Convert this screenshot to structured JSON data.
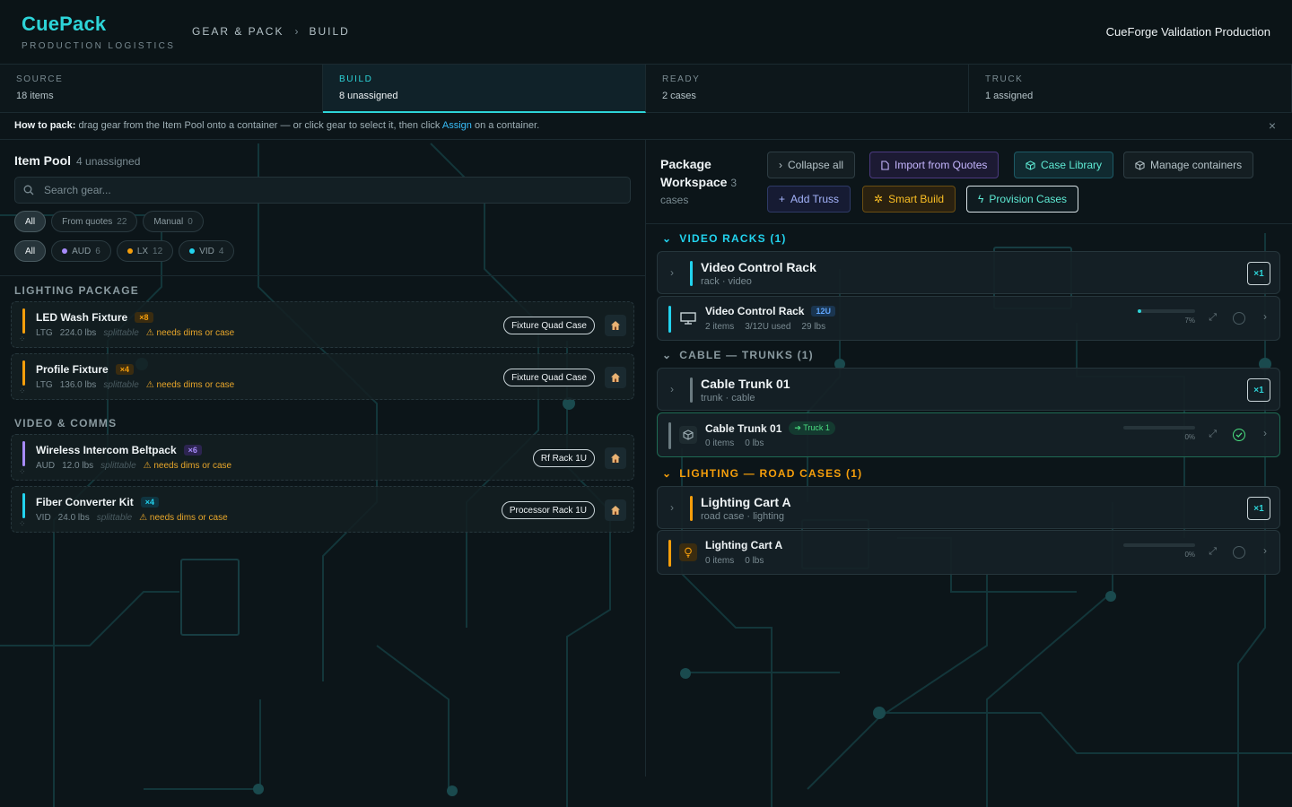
{
  "header": {
    "brand": "CuePack",
    "brand_sub": "PRODUCTION LOGISTICS",
    "crumbs": [
      "GEAR & PACK",
      "BUILD"
    ],
    "crumb_sep": "›",
    "production": "CueForge Validation Production"
  },
  "steps": [
    {
      "label": "SOURCE",
      "value": "18 items"
    },
    {
      "label": "BUILD",
      "value": "8 unassigned"
    },
    {
      "label": "READY",
      "value": "2 cases"
    },
    {
      "label": "TRUCK",
      "value": "1 assigned"
    }
  ],
  "tip": {
    "lead": "How to pack:",
    "text_a": " drag gear from the Item Pool onto a container — or click gear to select it, then click ",
    "assign": "Assign",
    "text_b": " on a container.",
    "close": "×"
  },
  "pool": {
    "title": "Item Pool",
    "count": "4 unassigned",
    "search_placeholder": "Search gear...",
    "source_filters": [
      {
        "label": "All",
        "count": ""
      },
      {
        "label": "From quotes",
        "count": "22"
      },
      {
        "label": "Manual",
        "count": "0"
      }
    ],
    "dept_filters": [
      {
        "label": "All",
        "count": "",
        "color": ""
      },
      {
        "label": "AUD",
        "count": "6",
        "color": "#a78bfa"
      },
      {
        "label": "LX",
        "count": "12",
        "color": "#f59e0b"
      },
      {
        "label": "VID",
        "count": "4",
        "color": "#22d3ee"
      }
    ],
    "sections": [
      {
        "title": "LIGHTING PACKAGE",
        "items": [
          {
            "name": "LED Wash Fixture",
            "qty": "×8",
            "dept": "LTG",
            "weight": "224.0 lbs",
            "split": "splittable",
            "warn": "⚠ needs dims or case",
            "suggest": "Fixture Quad Case",
            "color": "#f59e0b"
          },
          {
            "name": "Profile Fixture",
            "qty": "×4",
            "dept": "LTG",
            "weight": "136.0 lbs",
            "split": "splittable",
            "warn": "⚠ needs dims or case",
            "suggest": "Fixture Quad Case",
            "color": "#f59e0b"
          }
        ]
      },
      {
        "title": "VIDEO & COMMS",
        "items": [
          {
            "name": "Wireless Intercom Beltpack",
            "qty": "×6",
            "dept": "AUD",
            "weight": "12.0 lbs",
            "split": "splittable",
            "warn": "⚠ needs dims or case",
            "suggest": "Rf Rack 1U",
            "color": "#a78bfa"
          },
          {
            "name": "Fiber Converter Kit",
            "qty": "×4",
            "dept": "VID",
            "weight": "24.0 lbs",
            "split": "splittable",
            "warn": "⚠ needs dims or case",
            "suggest": "Processor Rack 1U",
            "color": "#22d3ee"
          }
        ]
      }
    ]
  },
  "workspace": {
    "title": "Package Workspace",
    "count": "3",
    "cases_label": "cases",
    "buttons": {
      "collapse": "Collapse all",
      "import": "Import from Quotes",
      "library": "Case Library",
      "manage": "Manage containers",
      "truss": "Add Truss",
      "smart": "Smart Build",
      "provision": "Provision Cases"
    },
    "groups": [
      {
        "title": "VIDEO RACKS (1)",
        "color": "#22d3ee",
        "row": {
          "name": "Video Control Rack",
          "sub": "rack · video",
          "mult": "×1"
        },
        "container": {
          "name": "Video Control Rack",
          "badge": "12U",
          "items": "2 items",
          "used": "3/12U used",
          "weight": "29 lbs",
          "fill": 0.07,
          "pct": "7%"
        }
      },
      {
        "title": "CABLE — TRUNKS (1)",
        "color": "#8a9aa0",
        "row": {
          "name": "Cable Trunk 01",
          "sub": "trunk · cable",
          "mult": "×1"
        },
        "container": {
          "name": "Cable Trunk 01",
          "badge": "➔ Truck 1",
          "items": "0 items",
          "weight": "0 lbs",
          "fill": 0,
          "pct": "0%"
        }
      },
      {
        "title": "LIGHTING — ROAD CASES (1)",
        "color": "#f59e0b",
        "row": {
          "name": "Lighting Cart A",
          "sub": "road case · lighting",
          "mult": "×1"
        },
        "container": {
          "name": "Lighting Cart A",
          "items": "0 items",
          "weight": "0 lbs",
          "fill": 0,
          "pct": "0%"
        }
      }
    ]
  }
}
